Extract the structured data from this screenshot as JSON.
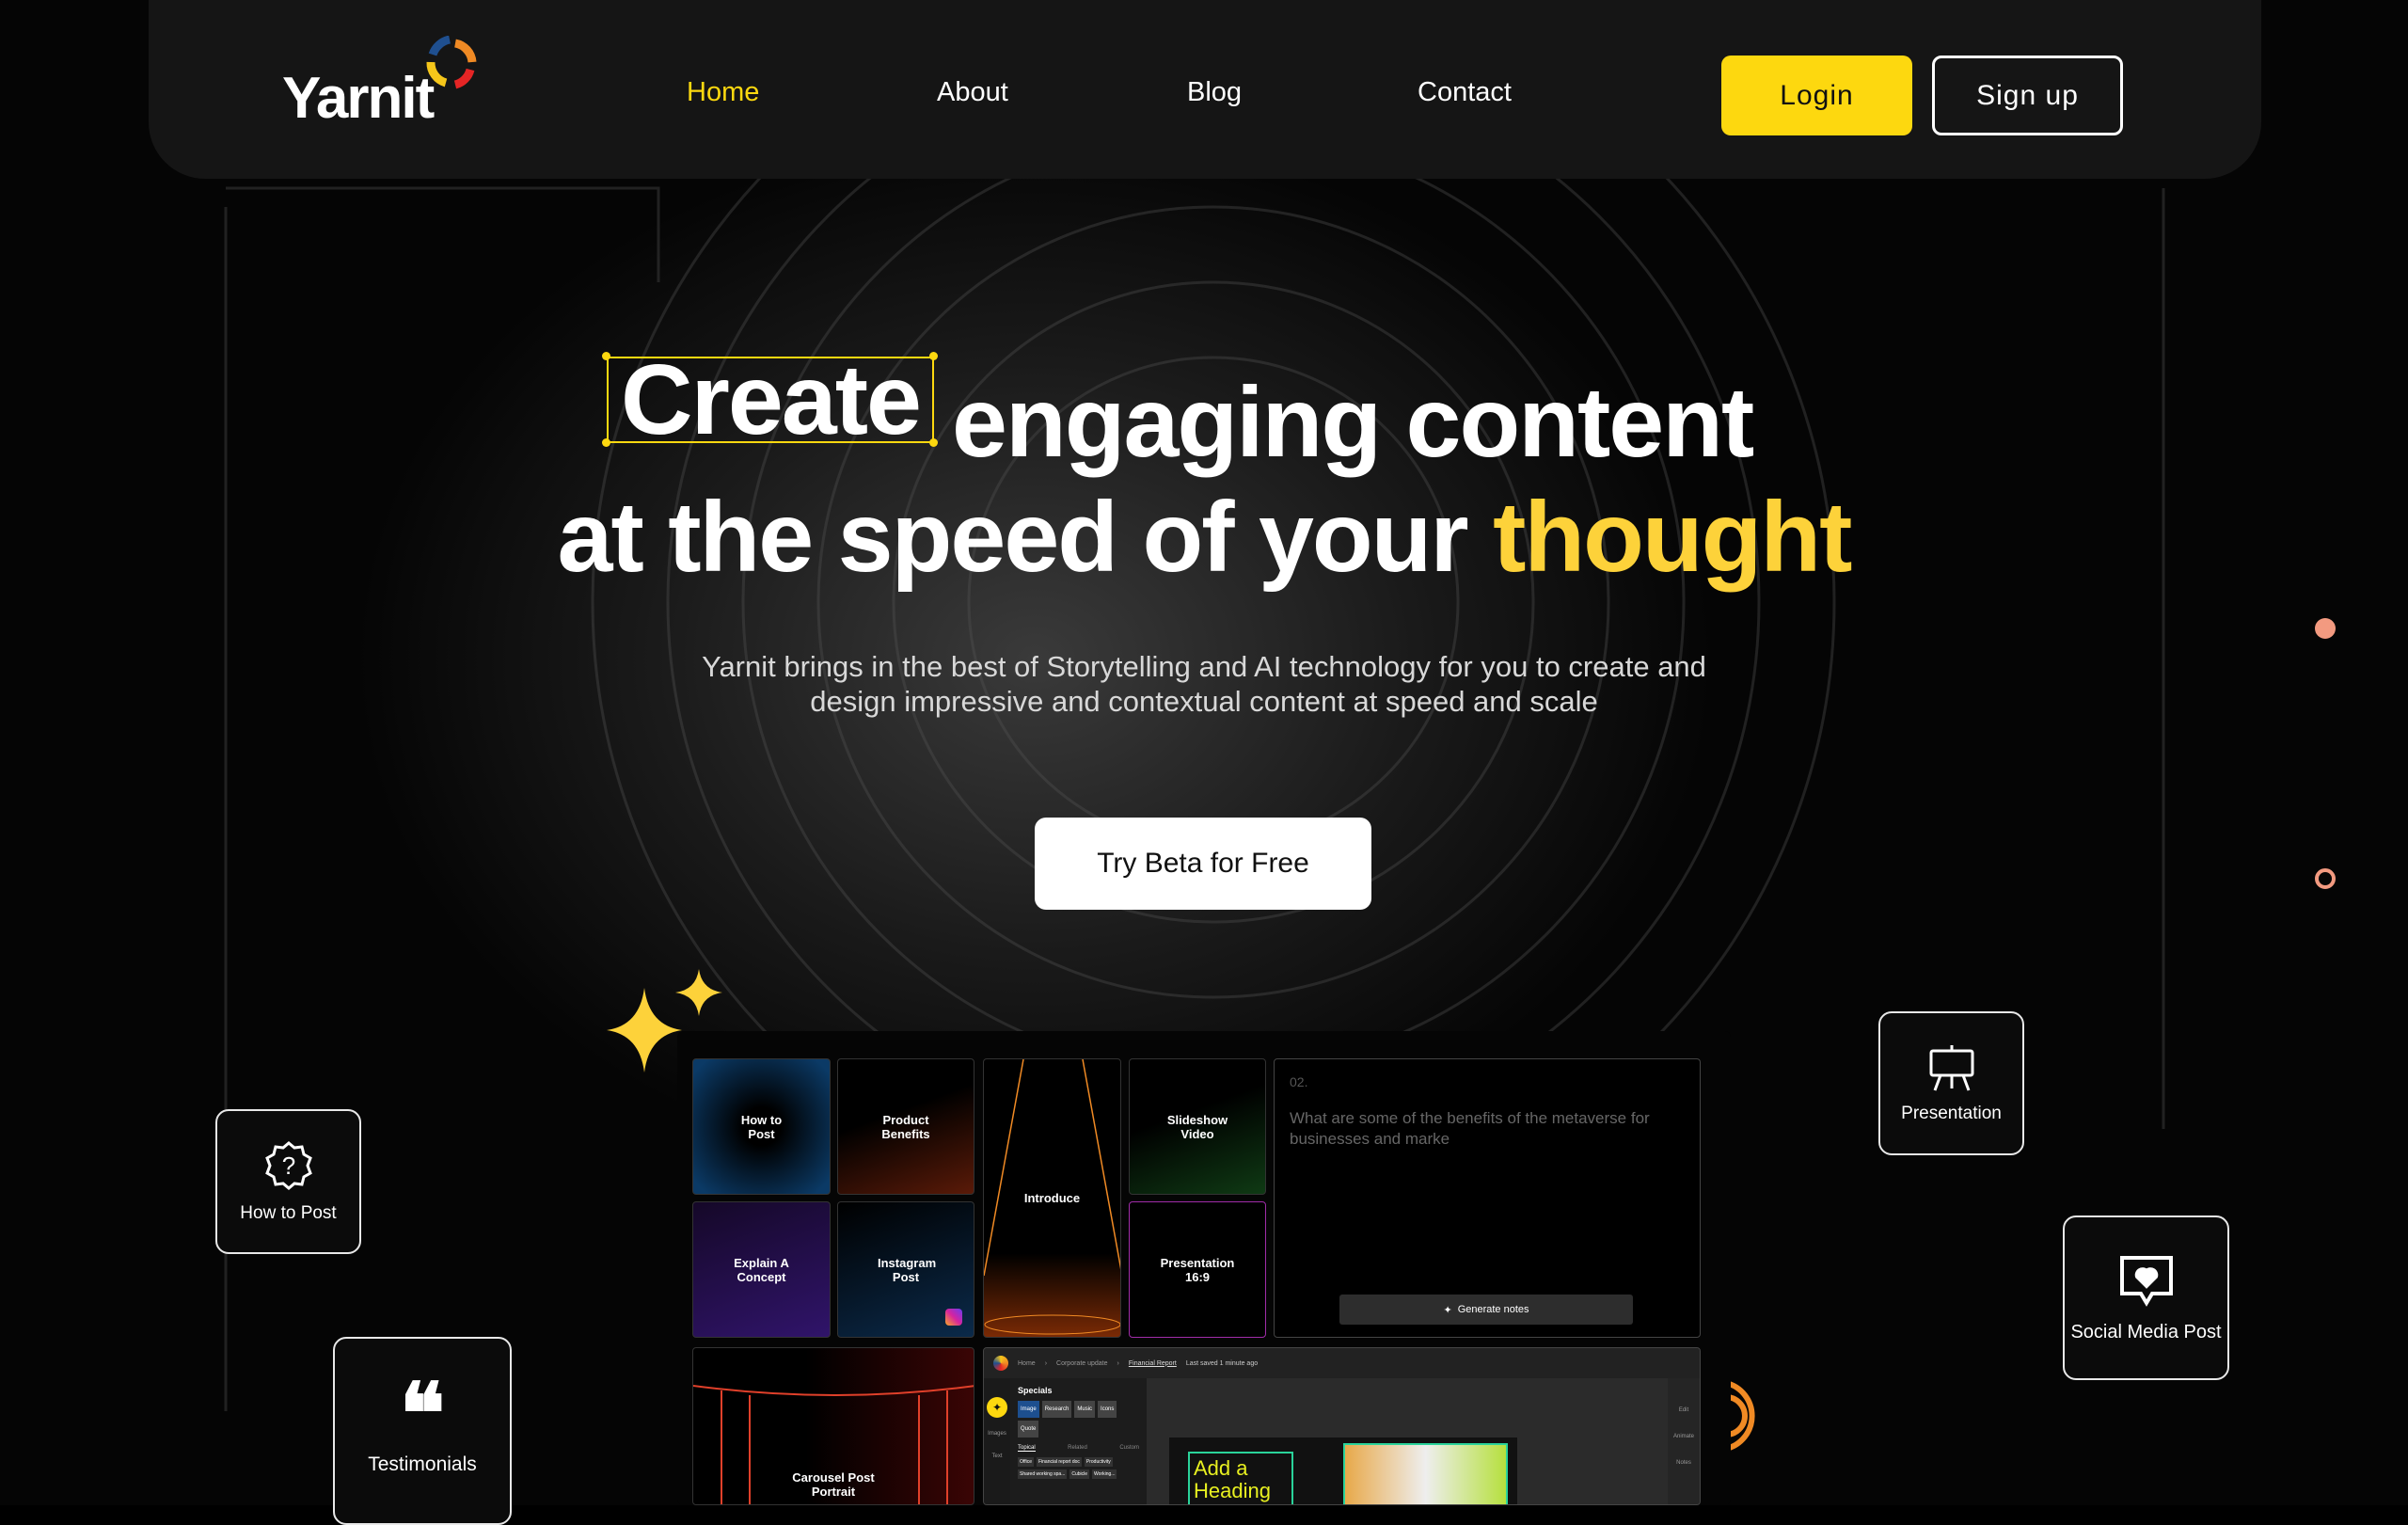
{
  "nav": {
    "brand": "Yarnit",
    "links": [
      "Home",
      "About",
      "Blog",
      "Contact"
    ],
    "login": "Login",
    "signup": "Sign up",
    "accent": "#fdd80f"
  },
  "hero": {
    "word_create": "Create",
    "line1_rest": "engaging content",
    "line2_start": "at the speed of your",
    "line2_highlight": "thought",
    "subtitle_1": "Yarnit brings in the best of Storytelling and AI technology for you to create and",
    "subtitle_2": "design impressive and contextual content at speed and scale",
    "cta": "Try Beta for Free"
  },
  "cards": {
    "how_to_post": "How to Post",
    "testimonials": "Testimonials",
    "presentation": "Presentation",
    "social": "Social Media Post"
  },
  "mockup": {
    "tiles": [
      "How to Post",
      "Product Benefits",
      "Introduce",
      "Slideshow Video",
      "Explain A Concept",
      "Instagram Post",
      "Presentation 16:9",
      "Carousel Post Portrait"
    ],
    "notes": {
      "number": "02.",
      "text": "What are some of the benefits of the metaverse for businesses and marke",
      "button": "Generate notes"
    },
    "editor": {
      "breadcrumb": [
        "Home",
        "Corporate update",
        "Financial Report"
      ],
      "saved": "Last saved 1 minute ago",
      "panel_title": "Specials",
      "chips": [
        "Image",
        "Research",
        "Music",
        "Icons",
        "Quote"
      ],
      "tabs": [
        "Topical",
        "Related",
        "Custom"
      ],
      "tags": [
        "Office",
        "Financial report doc",
        "Productivity",
        "Shared working spa...",
        "Cubicle",
        "Working..."
      ],
      "side_left": [
        "Images",
        "Text"
      ],
      "side_right": [
        "Edit",
        "Animate",
        "Notes"
      ],
      "heading": "Add a Heading"
    }
  }
}
